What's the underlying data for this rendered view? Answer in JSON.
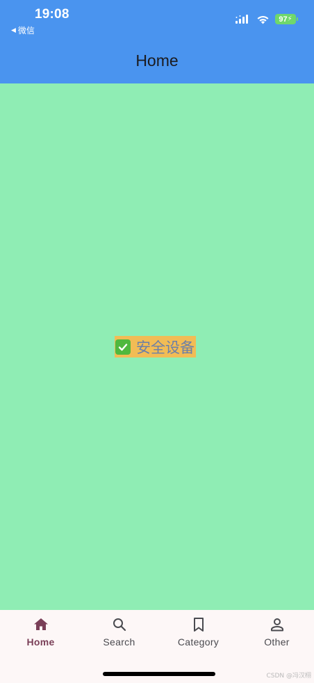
{
  "status_bar": {
    "time": "19:08",
    "back_app": "微信",
    "battery": "97"
  },
  "app_bar": {
    "title": "Home"
  },
  "body": {
    "status_text": "安全设备"
  },
  "bottom_nav": {
    "items": [
      {
        "label": "Home",
        "icon": "home-icon",
        "active": true
      },
      {
        "label": "Search",
        "icon": "search-icon",
        "active": false
      },
      {
        "label": "Category",
        "icon": "bookmark-icon",
        "active": false
      },
      {
        "label": "Other",
        "icon": "person-icon",
        "active": false
      }
    ]
  },
  "watermark": "CSDN @冯汉栩",
  "colors": {
    "app_bar": "#4a94ef",
    "body": "#8fedb4",
    "chip": "#f2bc55",
    "active_nav": "#7a3f58"
  }
}
